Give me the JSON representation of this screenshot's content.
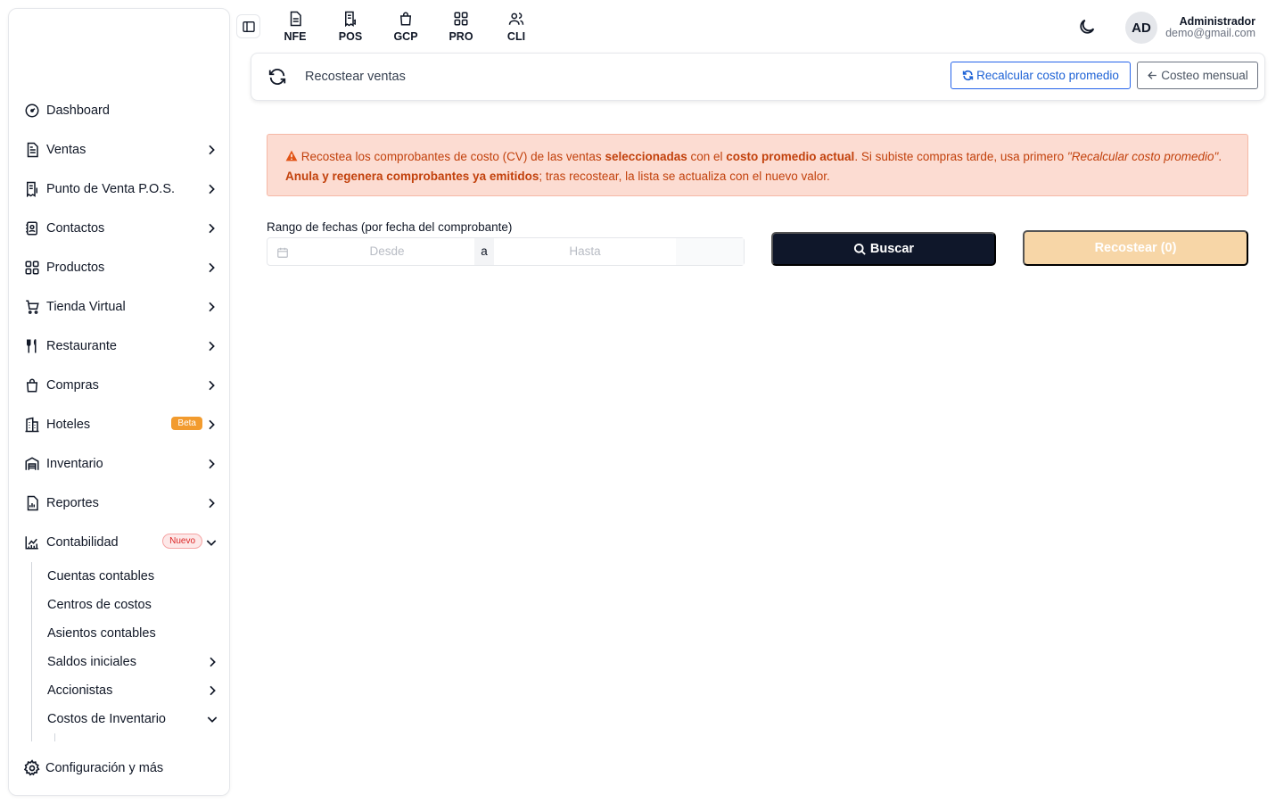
{
  "sidebar": {
    "items": [
      {
        "label": "Dashboard",
        "icon": "dashboard-icon"
      },
      {
        "label": "Ventas",
        "icon": "document-icon"
      },
      {
        "label": "Punto de Venta P.O.S.",
        "icon": "receipt-icon"
      },
      {
        "label": "Contactos",
        "icon": "contacts-icon"
      },
      {
        "label": "Productos",
        "icon": "grid-icon"
      },
      {
        "label": "Tienda Virtual",
        "icon": "cart-icon"
      },
      {
        "label": "Restaurante",
        "icon": "utensils-icon"
      },
      {
        "label": "Compras",
        "icon": "shopping-bag-icon"
      },
      {
        "label": "Hoteles",
        "icon": "building-icon",
        "badge": "Beta"
      },
      {
        "label": "Inventario",
        "icon": "warehouse-icon"
      },
      {
        "label": "Reportes",
        "icon": "report-icon"
      },
      {
        "label": "Contabilidad",
        "icon": "chart-icon",
        "badge": "Nuevo"
      }
    ],
    "sub_items": [
      {
        "label": "Cuentas contables"
      },
      {
        "label": "Centros de costos"
      },
      {
        "label": "Asientos contables"
      },
      {
        "label": "Saldos iniciales"
      },
      {
        "label": "Accionistas"
      },
      {
        "label": "Costos de Inventario"
      }
    ],
    "footer_label": "Configuración y más"
  },
  "apps": [
    {
      "label": "NFE",
      "icon": "file-icon"
    },
    {
      "label": "POS",
      "icon": "receipt-dollar-icon"
    },
    {
      "label": "GCP",
      "icon": "bag-icon"
    },
    {
      "label": "PRO",
      "icon": "grid-icon"
    },
    {
      "label": "CLI",
      "icon": "users-icon"
    }
  ],
  "user": {
    "initials": "AD",
    "name": "Administrador",
    "email": "demo@gmail.com"
  },
  "page": {
    "title": "Recostear ventas",
    "recalc_button": "Recalcular costo promedio",
    "costeo_button": "Costeo mensual"
  },
  "alert": {
    "t1": "Recostea los comprobantes de costo (CV) de las ventas ",
    "b1": "seleccionadas",
    "t2": " con el ",
    "b2": "costo promedio actual",
    "t3": ". Si subiste compras tarde, usa primero ",
    "i1": "\"Recalcular costo promedio\"",
    "t4": ". ",
    "b3": "Anula y regenera comprobantes ya emitidos",
    "t5": "; tras recostear, la lista se actualiza con el nuevo valor."
  },
  "filters": {
    "range_label": "Rango de fechas (por fecha del comprobante)",
    "from_placeholder": "Desde",
    "separator": "a",
    "to_placeholder": "Hasta",
    "search_button": "Buscar",
    "recost_button": "Recostear (0)"
  },
  "colors": {
    "primary_dark": "#0f172a",
    "accent_blue": "#1d62d6",
    "alert_bg": "#fcdcd2",
    "alert_text": "#c2410c",
    "recost_disabled": "#f7d6a7"
  }
}
